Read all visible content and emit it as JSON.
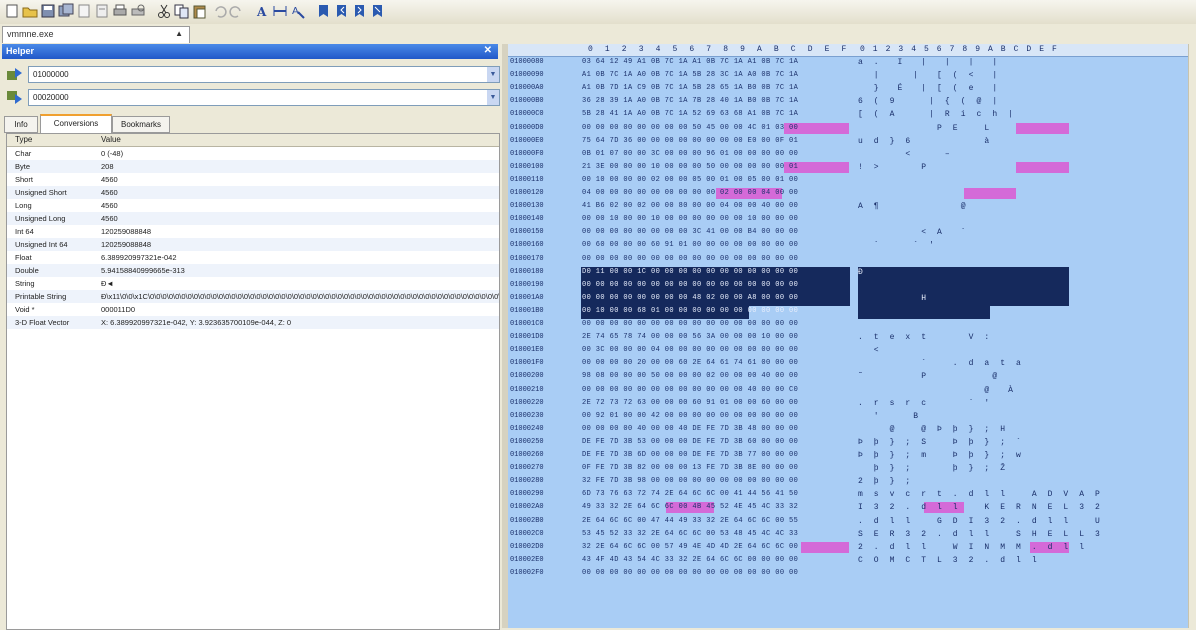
{
  "toolbar": {
    "buttons": [
      {
        "name": "new-icon"
      },
      {
        "name": "open-icon"
      },
      {
        "name": "save-icon"
      },
      {
        "name": "save-all-icon"
      },
      {
        "name": "close-file-icon"
      },
      {
        "name": "properties-icon"
      },
      {
        "name": "print-icon"
      },
      {
        "name": "print-preview-icon"
      },
      {
        "name": "cut-icon"
      },
      {
        "name": "copy-icon"
      },
      {
        "name": "paste-icon"
      },
      {
        "name": "undo-icon"
      },
      {
        "name": "redo-icon"
      },
      {
        "name": "font-icon"
      },
      {
        "name": "width-icon"
      },
      {
        "name": "find-icon"
      },
      {
        "name": "bookmark-icon"
      },
      {
        "name": "bookmark-prev-icon"
      },
      {
        "name": "bookmark-next-icon"
      },
      {
        "name": "bookmark-clear-icon"
      }
    ]
  },
  "document_tab": {
    "label": "vmmne.exe",
    "close": "▲"
  },
  "helper": {
    "title": "Helper",
    "close": "✕",
    "address_start": "01000000",
    "address_end": "00020000",
    "tabs": [
      "Info",
      "Conversions",
      "Bookmarks"
    ],
    "active_tab": "Conversions",
    "columns": {
      "type": "Type",
      "value": "Value"
    },
    "rows": [
      {
        "type": "Char",
        "value": "0 (-48)"
      },
      {
        "type": "Byte",
        "value": "208"
      },
      {
        "type": "Short",
        "value": "4560"
      },
      {
        "type": "Unsigned Short",
        "value": "4560"
      },
      {
        "type": "Long",
        "value": "4560"
      },
      {
        "type": "Unsigned Long",
        "value": "4560"
      },
      {
        "type": "Int 64",
        "value": "120259088848"
      },
      {
        "type": "Unsigned Int 64",
        "value": "120259088848"
      },
      {
        "type": "Float",
        "value": "6.389920997321e-042"
      },
      {
        "type": "Double",
        "value": "5.94158840999665e-313"
      },
      {
        "type": "String",
        "value": "Ð◄"
      },
      {
        "type": "Printable String",
        "value": "Ð\\x11\\0\\0\\x1C\\0\\0\\0\\0\\0\\0\\0\\0\\0\\0\\0\\0\\0\\0\\0\\0\\0\\0\\0\\0\\0\\0\\0\\0\\0\\0\\0\\0\\0\\0\\0\\0\\0\\0\\0\\0\\0\\0\\0\\0\\0\\0\\0\\0\\0\\0\\0\\0\\0\\0\\0\\0\\0\\0\\0\\0\\0\\0\\0\\0\\0\\0\\0\\0\\0\\0\\0\\0"
      },
      {
        "type": "Void *",
        "value": "000011D0"
      },
      {
        "type": "3-D Float Vector",
        "value": "X: 6.389920997321e-042, Y: 3.923635700109e-044, Z: 0"
      }
    ]
  },
  "hex": {
    "ruler_hex": [
      "0",
      "1",
      "2",
      "3",
      "4",
      "5",
      "6",
      "7",
      "8",
      "9",
      "A",
      "B",
      "C",
      "D",
      "E",
      "F"
    ],
    "ruler_ascii": "0123456789ABCDEF",
    "rows": [
      {
        "addr": "01000080",
        "hex": "03 64 12 49 A1 0B 7C 1A A1 0B 7C 1A A1 0B 7C 1A",
        "ascii": "a .  I  |  |  |  |"
      },
      {
        "addr": "01000090",
        "hex": "A1 0B 7C 1A A0 0B 7C 1A 5B 28 3C 1A A0 0B 7C 1A",
        "ascii": "  |    |  [ ( <  |"
      },
      {
        "addr": "010000A0",
        "hex": "A1 0B 7D 1A C9 0B 7C 1A 5B 28 65 1A B0 0B 7C 1A",
        "ascii": "  }  É  | [ ( e  |"
      },
      {
        "addr": "010000B0",
        "hex": "36 28 39 1A A0 0B 7C 1A 7B 28 40 1A B0 0B 7C 1A",
        "ascii": "6 ( 9    | { ( @ |"
      },
      {
        "addr": "010000C0",
        "hex": "5B 28 41 1A A0 0B 7C 1A 52 69 63 68 A1 0B 7C 1A",
        "ascii": "[ ( A    | R i c h |"
      },
      {
        "addr": "010000D0",
        "hex": "00 00 00 00 00 00 00 00 50 45 00 00 4C 01 03 00",
        "ascii": "          P E   L"
      },
      {
        "addr": "010000E0",
        "hex": "75 64 7D 36 00 00 00 00 00 00 00 00 E0 00 0F 01",
        "ascii": "u d } 6         à"
      },
      {
        "addr": "010000F0",
        "hex": "0B 01 07 00 00 3C 00 00 00 96 01 00 00 00 00 00",
        "ascii": "      <    –"
      },
      {
        "addr": "01000100",
        "hex": "21 3E 00 00 00 10 00 00 00 50 00 00 00 00 00 01",
        "ascii": "! >     P"
      },
      {
        "addr": "01000110",
        "hex": "00 10 00 00 00 02 00 00 05 00 01 00 05 00 01 00",
        "ascii": ""
      },
      {
        "addr": "01000120",
        "hex": "04 00 00 00 00 00 00 00 00 00 02 00 00 04 00 00",
        "ascii": ""
      },
      {
        "addr": "01000130",
        "hex": "41 B6 02 00 02 00 00 80 00 00 04 00 00 40 00 00",
        "ascii": "A ¶          @"
      },
      {
        "addr": "01000140",
        "hex": "00 00 10 00 00 10 00 00 00 00 00 00 10 00 00 00",
        "ascii": ""
      },
      {
        "addr": "01000150",
        "hex": "00 00 00 00 00 00 00 00 3C 41 00 00 B4 00 00 00",
        "ascii": "        < A  ´"
      },
      {
        "addr": "01000160",
        "hex": "00 60 00 00 00 60 91 01 00 00 00 00 00 00 00 00",
        "ascii": "  `    ` '"
      },
      {
        "addr": "01000170",
        "hex": "00 00 00 00 00 00 00 00 00 00 00 00 00 00 00 00",
        "ascii": ""
      },
      {
        "addr": "01000180",
        "hex": "D0 11 00 00 1C 00 00 00 00 00 00 00 00 00 00 00",
        "ascii": "Ð"
      },
      {
        "addr": "01000190",
        "hex": "00 00 00 00 00 00 00 00 00 00 00 00 00 00 00 00",
        "ascii": ""
      },
      {
        "addr": "010001A0",
        "hex": "00 00 00 00 00 00 00 00 48 02 00 00 A8 00 00 00",
        "ascii": "        H"
      },
      {
        "addr": "010001B0",
        "hex": "00 10 00 00 68 01 00 00 00 00 00 00 00 00 00 00",
        "ascii": ""
      },
      {
        "addr": "010001C0",
        "hex": "00 00 00 00 00 00 00 00 00 00 00 00 00 00 00 00",
        "ascii": ""
      },
      {
        "addr": "010001D0",
        "hex": "2E 74 65 78 74 00 00 00 56 3A 00 00 00 10 00 00",
        "ascii": ". t e x t     V :"
      },
      {
        "addr": "010001E0",
        "hex": "00 3C 00 00 00 04 00 00 00 00 00 00 00 00 00 00",
        "ascii": "  <"
      },
      {
        "addr": "010001F0",
        "hex": "00 00 00 00 20 00 00 60 2E 64 61 74 61 00 00 00",
        "ascii": "        `   . d a t a"
      },
      {
        "addr": "01000200",
        "hex": "98 08 00 00 00 50 00 00 00 02 00 00 00 40 00 00",
        "ascii": "˜       P        @"
      },
      {
        "addr": "01000210",
        "hex": "00 00 00 00 00 00 00 00 00 00 00 00 40 00 00 C0",
        "ascii": "                @  À"
      },
      {
        "addr": "01000220",
        "hex": "2E 72 73 72 63 00 00 00 60 91 01 00 00 60 00 00",
        "ascii": ". r s r c     ` '"
      },
      {
        "addr": "01000230",
        "hex": "00 92 01 00 00 42 00 00 00 00 00 00 00 00 00 00",
        "ascii": "  '    B"
      },
      {
        "addr": "01000240",
        "hex": "00 00 00 00 40 00 00 40 DE FE 7D 3B 48 00 00 00",
        "ascii": "    @   @ Þ þ } ; H"
      },
      {
        "addr": "01000250",
        "hex": "DE FE 7D 3B 53 00 00 00 DE FE 7D 3B 60 00 00 00",
        "ascii": "Þ þ } ; S   Þ þ } ; `"
      },
      {
        "addr": "01000260",
        "hex": "DE FE 7D 3B 6D 00 00 00 DE FE 7D 3B 77 00 00 00",
        "ascii": "Þ þ } ; m   Þ þ } ; w"
      },
      {
        "addr": "01000270",
        "hex": "0F FE 7D 3B 82 00 00 00 13 FE 7D 3B 8E 00 00 00",
        "ascii": "  þ } ;     þ } ; Ž"
      },
      {
        "addr": "01000280",
        "hex": "32 FE 7D 3B 98 00 00 00 00 00 00 00 00 00 00 00",
        "ascii": "2 þ } ;"
      },
      {
        "addr": "01000290",
        "hex": "6D 73 76 63 72 74 2E 64 6C 6C 00 41 44 56 41 50",
        "ascii": "m s v c r t . d l l   A D V A P"
      },
      {
        "addr": "010002A0",
        "hex": "49 33 32 2E 64 6C 6C 00 4B 45 52 4E 45 4C 33 32",
        "ascii": "I 3 2 . d l l   K E R N E L 3 2"
      },
      {
        "addr": "010002B0",
        "hex": "2E 64 6C 6C 00 47 44 49 33 32 2E 64 6C 6C 00 55",
        "ascii": ". d l l   G D I 3 2 . d l l   U"
      },
      {
        "addr": "010002C0",
        "hex": "53 45 52 33 32 2E 64 6C 6C 00 53 48 45 4C 4C 33",
        "ascii": "S E R 3 2 . d l l   S H E L L 3"
      },
      {
        "addr": "010002D0",
        "hex": "32 2E 64 6C 6C 00 57 49 4E 4D 4D 2E 64 6C 6C 00",
        "ascii": "2 . d l l   W I N M M . d l l"
      },
      {
        "addr": "010002E0",
        "hex": "43 4F 4D 43 54 4C 33 32 2E 64 6C 6C 00 00 00 00",
        "ascii": "C O M C T L 3 2 . d l l"
      },
      {
        "addr": "010002F0",
        "hex": "00 00 00 00 00 00 00 00 00 00 00 00 00 00 00 00",
        "ascii": ""
      }
    ]
  },
  "colors": {
    "hex_bg": "#a9cdf5",
    "highlight": "#d46ad8",
    "selection": "#15295c",
    "title_bar": "#2158c8"
  }
}
